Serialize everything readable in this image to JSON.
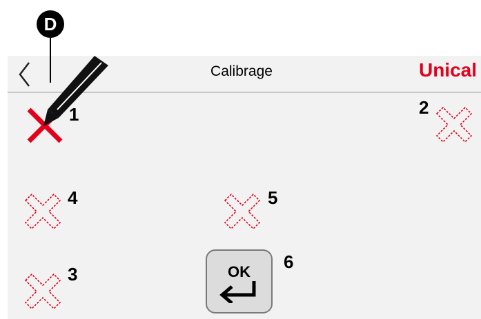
{
  "header": {
    "title": "Calibrage",
    "brand": "Unical"
  },
  "callout": {
    "letter": "D"
  },
  "targets": [
    {
      "number": "1",
      "state": "active"
    },
    {
      "number": "2",
      "state": "pending"
    },
    {
      "number": "3",
      "state": "pending"
    },
    {
      "number": "4",
      "state": "pending"
    },
    {
      "number": "5",
      "state": "pending"
    }
  ],
  "ok_button": {
    "label": "OK",
    "number": "6"
  },
  "colors": {
    "accent_red": "#e2001a",
    "screen_bg": "#f2f2f2",
    "divider": "#c7c7c7",
    "button_bg": "#dcdcdc"
  },
  "icons": {
    "back": "chevron-left-icon",
    "stylus": "stylus-pen-icon",
    "target_active": "solid-x-target-icon",
    "target_pending": "dashed-x-target-icon",
    "enter": "enter-return-icon"
  }
}
